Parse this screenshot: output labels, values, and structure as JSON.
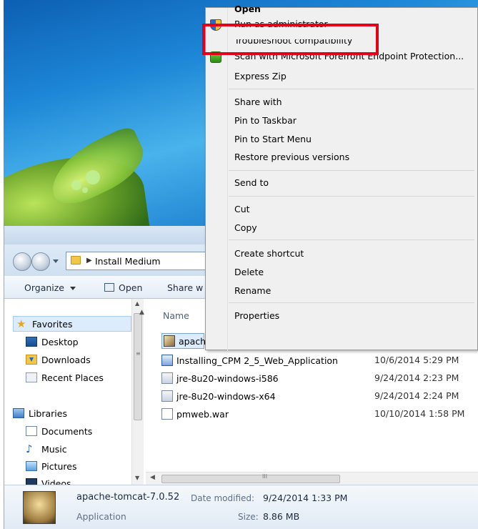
{
  "desktop": {},
  "explorer": {
    "address": {
      "path_label": "Install Medium"
    },
    "toolbar": {
      "organize": "Organize",
      "open": "Open",
      "share": "Share w"
    },
    "nav": {
      "favorites": "Favorites",
      "desktop": "Desktop",
      "downloads": "Downloads",
      "recent_places": "Recent Places",
      "libraries": "Libraries",
      "documents": "Documents",
      "music": "Music",
      "pictures": "Pictures",
      "videos": "Videos"
    },
    "columns": {
      "name": "Name"
    },
    "files": [
      {
        "name": "apach",
        "date": ""
      },
      {
        "name": "Installing_CPM 2_5_Web_Application",
        "date": "10/6/2014 5:29 PM"
      },
      {
        "name": "jre-8u20-windows-i586",
        "date": "9/24/2014 2:23 PM"
      },
      {
        "name": "jre-8u20-windows-x64",
        "date": "9/24/2014 2:24 PM"
      },
      {
        "name": "pmweb.war",
        "date": "10/10/2014 1:58 PM"
      }
    ],
    "details": {
      "name": "apache-tomcat-7.0.52",
      "type": "Application",
      "date_modified_label": "Date modified:",
      "date_modified_value": "9/24/2014 1:33 PM",
      "size_label": "Size:",
      "size_value": "8.86 MB"
    }
  },
  "context_menu": {
    "items": {
      "open": "Open",
      "run_as_admin": "Run as administrator",
      "troubleshoot": "Troubleshoot compatibility",
      "scan": "Scan with Microsoft Forefront Endpoint Protection...",
      "express_zip": "Express Zip",
      "share_with": "Share with",
      "pin_taskbar": "Pin to Taskbar",
      "pin_start": "Pin to Start Menu",
      "restore": "Restore previous versions",
      "send_to": "Send to",
      "cut": "Cut",
      "copy": "Copy",
      "create_shortcut": "Create shortcut",
      "delete": "Delete",
      "rename": "Rename",
      "properties": "Properties"
    }
  },
  "colors": {
    "highlight_border": "#e3001b",
    "menu_bg": "#f0f0f0",
    "selection_bg": "#dcecfc"
  }
}
